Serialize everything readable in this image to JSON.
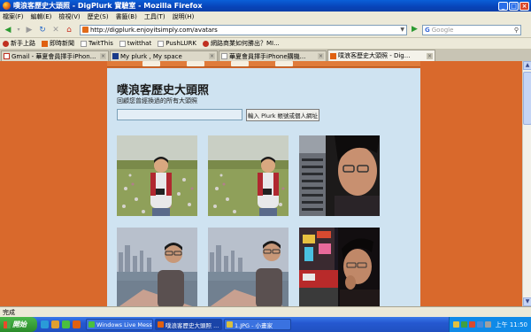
{
  "window": {
    "title": "噗浪客歷史大頭照 - DigPlurk 實驗室 - Mozilla Firefox"
  },
  "menu": [
    "檔案(F)",
    "編輯(E)",
    "檢視(V)",
    "歷史(S)",
    "書籤(B)",
    "工具(T)",
    "說明(H)"
  ],
  "nav": {
    "url": "http://digplurk.enjoyitsimply.com/avatars",
    "search_placeholder": "Google",
    "search_engine": "G"
  },
  "bookmarks": [
    "新手上路",
    "即時新聞",
    "TwitThis",
    "twitthat",
    "PushLURK",
    "網路商業如何勝出？MI..."
  ],
  "tabs": [
    {
      "label": "Gmail - 華夏會員擇手iPhon...",
      "icon": "gmail-icon",
      "active": false
    },
    {
      "label": "My plurk , My space",
      "icon": "myspace-icon",
      "active": false
    },
    {
      "label": "華夏會員擇手iPhone購機...",
      "icon": "page-icon",
      "active": false
    },
    {
      "label": "噗浪客歷史大頭照 - Dig...",
      "icon": "plurk-icon",
      "active": true
    }
  ],
  "page": {
    "title": "噗浪客歷史大頭照",
    "description": "回顧您曾經換過的所有大頭照",
    "input_value": "",
    "submit_label": "輸入 Plurk 帳號或個人網址"
  },
  "photos": [
    {
      "scene": "flowers",
      "alt": "avatar-1"
    },
    {
      "scene": "flowers",
      "alt": "avatar-2"
    },
    {
      "scene": "closeup",
      "alt": "avatar-3"
    },
    {
      "scene": "harbor",
      "alt": "avatar-4"
    },
    {
      "scene": "harbor",
      "alt": "avatar-5"
    },
    {
      "scene": "city-night",
      "alt": "avatar-6"
    }
  ],
  "status": {
    "text": "完成"
  },
  "taskbar": {
    "start_label": "開始",
    "items": [
      {
        "label": "Windows Live Messen...",
        "active": false
      },
      {
        "label": "噗浪客歷史大頭照 ...",
        "active": true
      },
      {
        "label": "1.JPG - 小畫家",
        "active": false
      }
    ],
    "clock": "上午 11:50"
  },
  "colors": {
    "page_background": "#d9692c",
    "panel_background": "#cfe3f1",
    "titlebar": "#0a5fd8",
    "taskbar": "#2558d0"
  }
}
